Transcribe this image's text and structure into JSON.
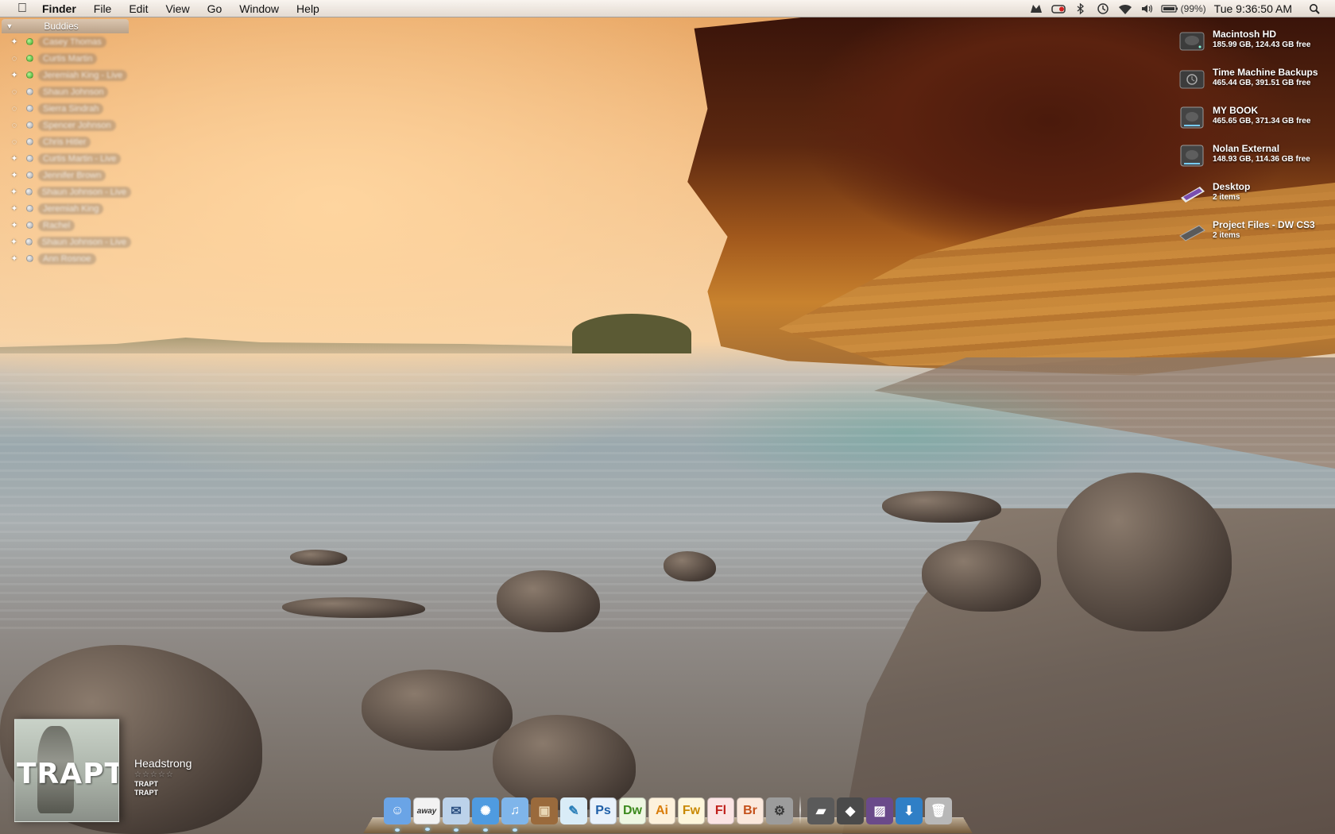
{
  "menubar": {
    "apple_icon": "apple-icon",
    "app_name": "Finder",
    "menus": [
      "File",
      "Edit",
      "View",
      "Go",
      "Window",
      "Help"
    ],
    "status_icons": [
      "growl-icon",
      "istat-icon",
      "bluetooth-icon",
      "time-machine-icon",
      "wifi-icon",
      "volume-icon",
      "battery-icon"
    ],
    "battery_percent": "(99%)",
    "clock": "Tue 9:36:50 AM",
    "spotlight_icon": "spotlight-icon"
  },
  "buddies": {
    "title": "Buddies",
    "items": [
      {
        "service": "aim",
        "status": "green",
        "name": "Casey Thomas"
      },
      {
        "service": "chat",
        "status": "green",
        "name": "Curtis Martin"
      },
      {
        "service": "aim",
        "status": "green",
        "name": "Jeremiah King - Live"
      },
      {
        "service": "chat",
        "status": "grey",
        "name": "Shaun Johnson"
      },
      {
        "service": "chat",
        "status": "grey",
        "name": "Sierra Sindrah"
      },
      {
        "service": "chat",
        "status": "grey",
        "name": "Spencer Johnson"
      },
      {
        "service": "chat",
        "status": "grey",
        "name": "Chris Hitler"
      },
      {
        "service": "aim",
        "status": "grey",
        "name": "Curtis Martin - Live"
      },
      {
        "service": "aim",
        "status": "grey",
        "name": "Jennifer Brown"
      },
      {
        "service": "aim",
        "status": "grey",
        "name": "Shaun Johnson - Live"
      },
      {
        "service": "aim",
        "status": "grey",
        "name": "Jeremiah King"
      },
      {
        "service": "aim",
        "status": "grey",
        "name": "Rachel"
      },
      {
        "service": "aim",
        "status": "grey",
        "name": "Shaun Johnson - Live"
      },
      {
        "service": "aim",
        "status": "grey",
        "name": "Ann Rosnoe"
      }
    ]
  },
  "volumes": [
    {
      "icon": "hard-drive-icon",
      "name": "Macintosh HD",
      "detail": "185.99 GB, 124.43 GB free"
    },
    {
      "icon": "time-machine-drive-icon",
      "name": "Time Machine Backups",
      "detail": "465.44 GB, 391.51 GB free"
    },
    {
      "icon": "external-drive-icon",
      "name": "MY BOOK",
      "detail": "465.65 GB, 371.34 GB free"
    },
    {
      "icon": "external-drive-icon",
      "name": "Nolan External",
      "detail": "148.93 GB, 114.36 GB free"
    },
    {
      "icon": "desktop-folder-icon",
      "name": "Desktop",
      "detail": "2 items"
    },
    {
      "icon": "folder-icon",
      "name": "Project Files - DW CS3",
      "detail": "2 items"
    }
  ],
  "now_playing": {
    "album_art_text": "TRAPT",
    "track": "Headstrong",
    "rating": "☆☆☆☆☆",
    "artist": "TRAPT",
    "album": "TRAPT"
  },
  "dock": {
    "apps": [
      {
        "name": "finder",
        "label": "",
        "glyph": "☺",
        "bg": "#6aa4e6",
        "fg": "#ffffff",
        "running": true
      },
      {
        "name": "adium",
        "label": "away",
        "glyph": "",
        "bg": "#f2f2f2",
        "fg": "#333333",
        "running": true
      },
      {
        "name": "mail",
        "label": "",
        "glyph": "✉",
        "bg": "#bcd2ea",
        "fg": "#2b4f80",
        "running": true
      },
      {
        "name": "safari",
        "label": "",
        "glyph": "✺",
        "bg": "#4f9be0",
        "fg": "#ffffff",
        "running": true
      },
      {
        "name": "itunes",
        "label": "",
        "glyph": "♫",
        "bg": "#7fb5ea",
        "fg": "#ffffff",
        "running": true
      },
      {
        "name": "iphoto",
        "label": "",
        "glyph": "▣",
        "bg": "#9a6a3c",
        "fg": "#e8d6b4",
        "running": false
      },
      {
        "name": "twitter-client",
        "label": "",
        "glyph": "✎",
        "bg": "#d9ecf7",
        "fg": "#2a7fb8",
        "running": false
      },
      {
        "name": "photoshop",
        "label": "Ps",
        "glyph": "",
        "bg": "#e8f1fb",
        "fg": "#1f5fa8",
        "running": false
      },
      {
        "name": "dreamweaver",
        "label": "Dw",
        "glyph": "",
        "bg": "#eef7e2",
        "fg": "#3c8a1e",
        "running": false
      },
      {
        "name": "illustrator",
        "label": "Ai",
        "glyph": "",
        "bg": "#fdf1dc",
        "fg": "#d97c0a",
        "running": false
      },
      {
        "name": "fireworks",
        "label": "Fw",
        "glyph": "",
        "bg": "#fdf6dc",
        "fg": "#c98a05",
        "running": false
      },
      {
        "name": "flash",
        "label": "Fl",
        "glyph": "",
        "bg": "#fbe4e4",
        "fg": "#c0211c",
        "running": false
      },
      {
        "name": "bridge",
        "label": "Br",
        "glyph": "",
        "bg": "#fbe8dc",
        "fg": "#c4501a",
        "running": false
      },
      {
        "name": "system-preferences",
        "label": "",
        "glyph": "⚙",
        "bg": "#9c9c9c",
        "fg": "#3a3a3a",
        "running": false
      }
    ],
    "stacks": [
      {
        "name": "applications-stack",
        "glyph": "▰",
        "bg": "#5a5a5a"
      },
      {
        "name": "documents-stack",
        "glyph": "◆",
        "bg": "#4a4a4a"
      },
      {
        "name": "desktop-stack",
        "glyph": "▨",
        "bg": "#6a4a8a"
      },
      {
        "name": "downloads-stack",
        "glyph": "⬇",
        "bg": "#2f7fc6"
      },
      {
        "name": "trash",
        "glyph": "🗑",
        "bg": "#b8b8b8"
      }
    ]
  }
}
